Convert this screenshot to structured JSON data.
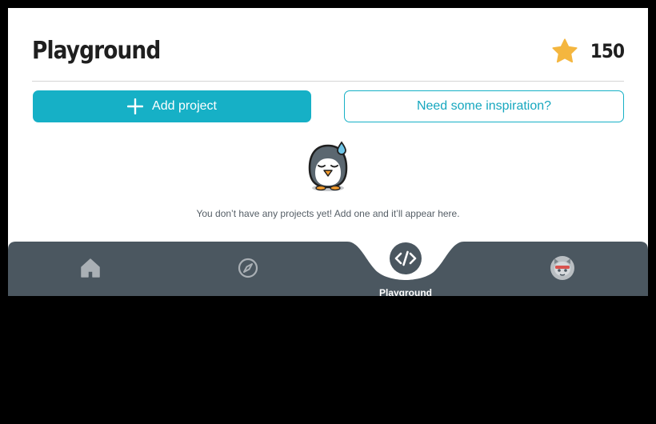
{
  "header": {
    "title": "Playground",
    "score": "150",
    "star_color": "#f4b63f"
  },
  "actions": {
    "add_label": "Add project",
    "inspire_label": "Need some inspiration?",
    "accent_color": "#16b0c6"
  },
  "empty_state": {
    "icon": "sweating-penguin-icon",
    "message": "You don’t have any projects yet! Add one and it’ll appear here."
  },
  "nav": {
    "background": "#4b5760",
    "items": [
      {
        "icon": "home-icon",
        "label": "",
        "active": false
      },
      {
        "icon": "compass-icon",
        "label": "",
        "active": false
      },
      {
        "icon": "code-icon",
        "label": "Playground",
        "active": true
      },
      {
        "icon": "avatar-icon",
        "label": "",
        "active": false
      }
    ]
  }
}
